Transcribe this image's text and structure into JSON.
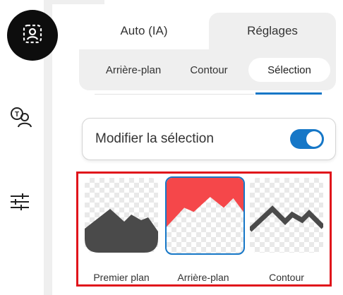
{
  "tabs": {
    "auto_label": "Auto (IA)",
    "reglages_label": "Réglages"
  },
  "subtabs": {
    "background_label": "Arrière-plan",
    "contour_label": "Contour",
    "selection_label": "Sélection"
  },
  "selection_toggle": {
    "label": "Modifier la sélection",
    "enabled": true
  },
  "modes": [
    {
      "label": "Premier plan",
      "icon": "foreground-mountain-icon",
      "selected": false
    },
    {
      "label": "Arrière-plan",
      "icon": "background-mountain-icon",
      "selected": true
    },
    {
      "label": "Contour",
      "icon": "contour-mountain-icon",
      "selected": false
    }
  ],
  "sidebar": {
    "items": [
      {
        "icon": "portrait-select-icon",
        "active": true
      },
      {
        "icon": "ai-person-icon",
        "active": false
      },
      {
        "icon": "sliders-icon",
        "active": false
      }
    ]
  },
  "colors": {
    "accent": "#1677c7",
    "highlight_border": "#e0141b",
    "background_fill": "#f5474a",
    "foreground_fill": "#4a4a4a"
  }
}
